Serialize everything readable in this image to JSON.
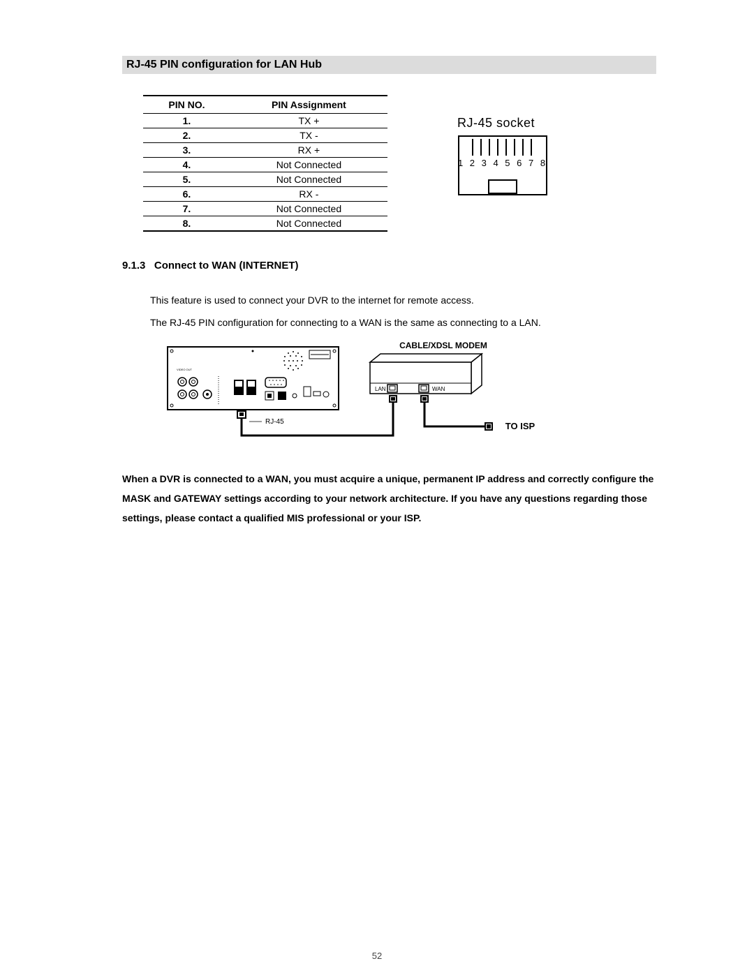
{
  "section_title": "RJ-45 PIN configuration for LAN Hub",
  "table": {
    "head_pin": "PIN NO.",
    "head_assign": "PIN Assignment",
    "rows": [
      {
        "no": "1.",
        "assign": "TX +"
      },
      {
        "no": "2.",
        "assign": "TX -"
      },
      {
        "no": "3.",
        "assign": "RX +"
      },
      {
        "no": "4.",
        "assign": "Not Connected"
      },
      {
        "no": "5.",
        "assign": "Not Connected"
      },
      {
        "no": "6.",
        "assign": "RX -"
      },
      {
        "no": "7.",
        "assign": "Not Connected"
      },
      {
        "no": "8.",
        "assign": "Not Connected"
      }
    ]
  },
  "socket": {
    "label": "RJ-45 socket",
    "pins": "1 2 3 4 5 6 7 8"
  },
  "subsection": {
    "number": "9.1.3",
    "title": "Connect to WAN (INTERNET)"
  },
  "para1": "This feature is used to connect your DVR to the internet for remote access.",
  "para2": "The RJ-45 PIN configuration for connecting to a WAN is the same as connecting to a LAN.",
  "diagram": {
    "modem_label": "CABLE/XDSL MODEM",
    "lan": "LAN",
    "wan": "WAN",
    "rj45": "RJ-45",
    "to_isp": "TO ISP"
  },
  "bold_para": "When a DVR is connected to a WAN, you must acquire a unique, permanent IP address and correctly configure the MASK and GATEWAY settings according to your network architecture. If you have any questions regarding those settings, please contact a qualified MIS professional or your ISP.",
  "page_num": "52"
}
